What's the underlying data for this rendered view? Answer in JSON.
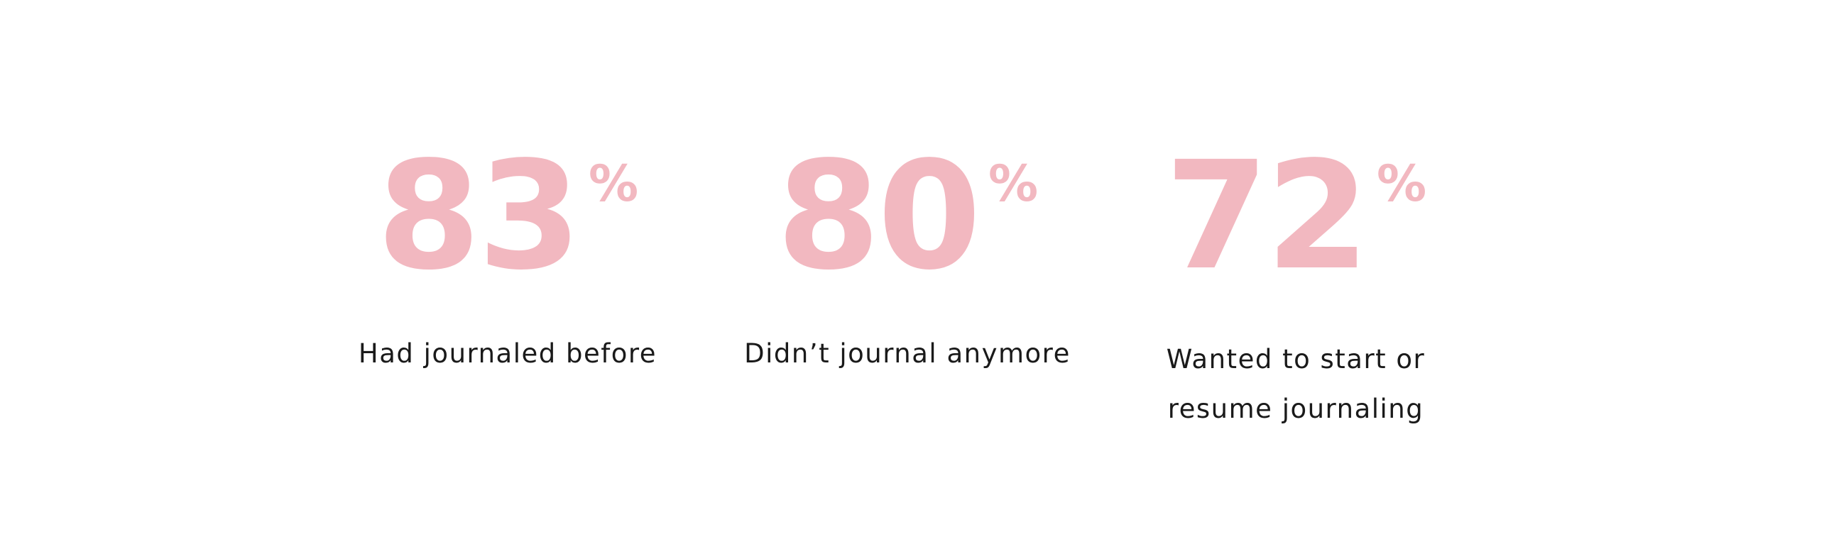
{
  "theme": {
    "accent_color": "#f2b8c0",
    "text_color": "#1a1a1a",
    "background": "#ffffff"
  },
  "stats": [
    {
      "value": "83",
      "unit": "%",
      "label": "Had journaled before"
    },
    {
      "value": "80",
      "unit": "%",
      "label": "Didn’t journal anymore"
    },
    {
      "value": "72",
      "unit": "%",
      "label": "Wanted to start or resume journaling"
    }
  ]
}
